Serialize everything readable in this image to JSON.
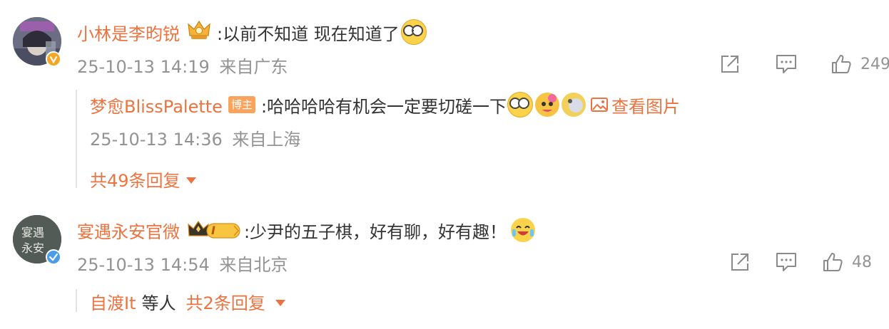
{
  "comments": [
    {
      "username": "小林是李昀锐",
      "text": ":以前不知道 现在知道了",
      "time": "25-10-13 14:19",
      "location": "来自广东",
      "likes": "249",
      "avatar_text": "",
      "reply": {
        "username": "梦愈BlissPalette",
        "badge": "博主",
        "text": ":哈哈哈哈有机会一定要切磋一下",
        "view_image": "查看图片",
        "time": "25-10-13 14:36",
        "location": "来自上海"
      },
      "more_replies": "共49条回复"
    },
    {
      "username": "宴遇永安官微",
      "text": ":少尹的五子棋，好有聊，好有趣！",
      "time": "25-10-13 14:54",
      "location": "来自北京",
      "likes": "48",
      "avatar_text": "宴遇永安",
      "level_badge": "I",
      "reply_summary": {
        "user": "自渡It",
        "suffix": "等人",
        "count": "共2条回复"
      }
    }
  ],
  "colors": {
    "username": "#eb7340",
    "text": "#333333",
    "meta": "#939393",
    "verified_orange": "#f5a623",
    "verified_blue": "#4a9be8"
  },
  "icons": [
    "share-icon",
    "comment-icon",
    "like-icon",
    "dropdown-triangle-icon",
    "image-icon"
  ]
}
